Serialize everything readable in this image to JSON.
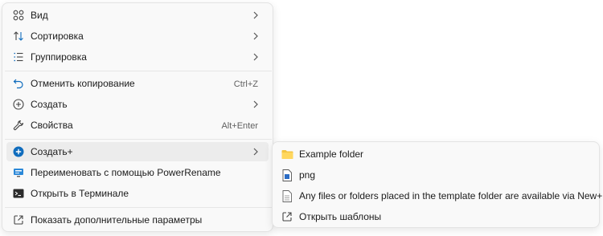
{
  "menu": {
    "items": [
      {
        "label": "Вид",
        "icon": "grid-view-icon"
      },
      {
        "label": "Сортировка",
        "icon": "sort-arrows-icon"
      },
      {
        "label": "Группировка",
        "icon": "group-list-icon"
      },
      {
        "label": "Отменить копирование",
        "shortcut": "Ctrl+Z",
        "icon": "undo-icon"
      },
      {
        "label": "Создать",
        "icon": "new-plus-circle-icon"
      },
      {
        "label": "Свойства",
        "shortcut": "Alt+Enter",
        "icon": "wrench-icon"
      },
      {
        "label": "Создать+",
        "icon": "new-plus-filled-icon"
      },
      {
        "label": "Переименовать с помощью PowerRename",
        "icon": "powerrename-icon"
      },
      {
        "label": "Открыть в Терминале",
        "icon": "terminal-icon"
      },
      {
        "label": "Показать дополнительные параметры",
        "icon": "open-external-icon"
      }
    ]
  },
  "submenu": {
    "items": [
      {
        "label": "Example folder",
        "icon": "folder-icon"
      },
      {
        "label": "png",
        "icon": "image-file-icon"
      },
      {
        "label": "Any files or folders placed in the template folder are available via New+",
        "icon": "document-icon"
      },
      {
        "label": "Открыть шаблоны",
        "icon": "open-external-icon"
      }
    ]
  },
  "colors": {
    "accent": "#0f6cbd",
    "folder": "#f4c542",
    "hover": "#ececec"
  }
}
